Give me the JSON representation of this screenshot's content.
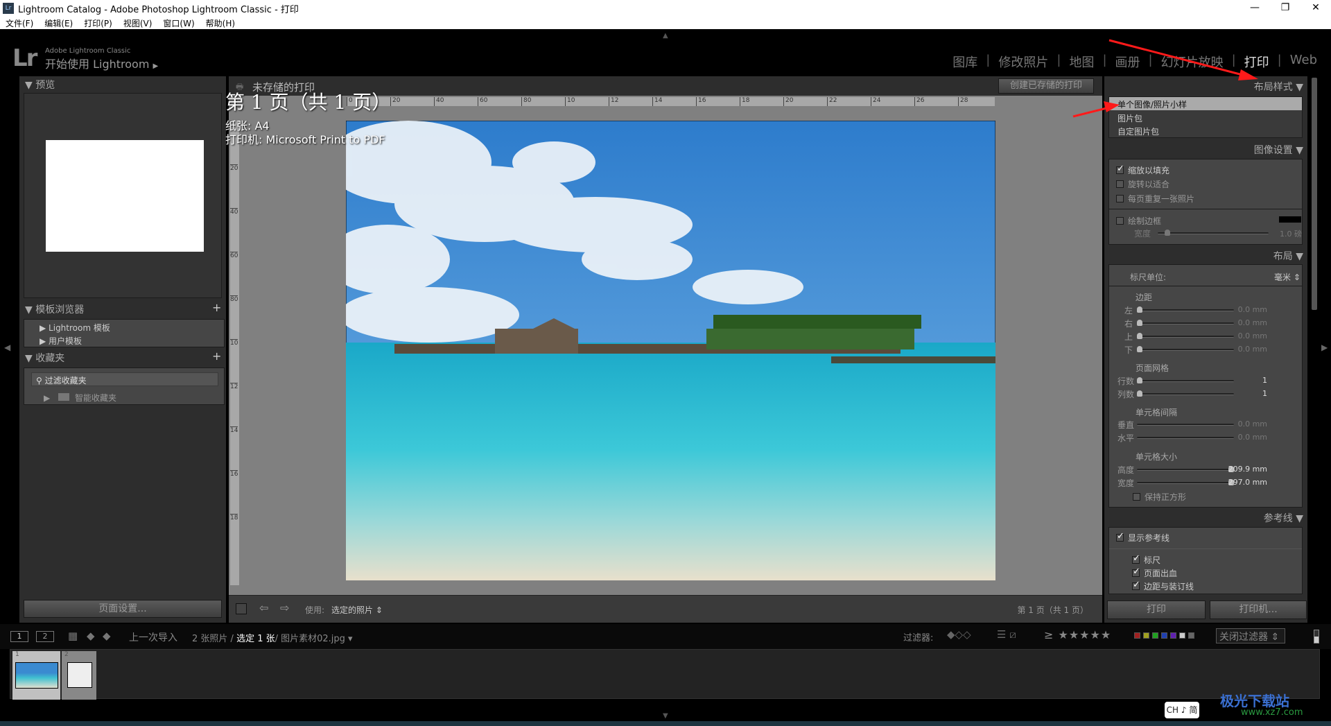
{
  "window": {
    "title": "Lightroom Catalog - Adobe Photoshop Lightroom Classic - 打印",
    "app_icon": "Lr",
    "controls": [
      "minimize-icon",
      "maximize-icon",
      "close-icon"
    ]
  },
  "menu": [
    "文件(F)",
    "编辑(E)",
    "打印(P)",
    "视图(V)",
    "窗口(W)",
    "帮助(H)"
  ],
  "identity": {
    "logo": "Lr",
    "brand": "Adobe Lightroom Classic",
    "subtitle": "开始使用 Lightroom"
  },
  "modules": [
    {
      "label": "图库"
    },
    {
      "label": "修改照片"
    },
    {
      "label": "地图"
    },
    {
      "label": "画册"
    },
    {
      "label": "幻灯片放映"
    },
    {
      "label": "打印",
      "active": true
    },
    {
      "label": "Web"
    }
  ],
  "left": {
    "preview_title": "预览",
    "template_browser": {
      "title": "模板浏览器",
      "items": [
        "Lightroom 模板",
        "用户模板"
      ]
    },
    "collections": {
      "title": "收藏夹",
      "filter_placeholder": "过滤收藏夹",
      "items": [
        "智能收藏夹"
      ]
    },
    "page_setup": "页面设置..."
  },
  "center": {
    "print_title": "未存储的打印",
    "create_saved": "创建已存储的打印",
    "ruler_top": [
      "0",
      "20",
      "40",
      "60",
      "80",
      "10",
      "12",
      "14",
      "16",
      "18",
      "20",
      "22",
      "24",
      "26",
      "28"
    ],
    "ruler_left": [
      "0",
      "20",
      "40",
      "60",
      "80",
      "10",
      "12",
      "14",
      "16",
      "18"
    ],
    "page_info": {
      "page": "第 1 页（共 1 页）",
      "paper": "纸张: A4",
      "printer": "打印机: Microsoft Print to PDF"
    },
    "toolbar": {
      "use_label": "使用:",
      "use_value": "选定的照片",
      "page_status": "第 1 页（共 1 页）"
    }
  },
  "right": {
    "layout_style": {
      "title": "布局样式",
      "items": [
        "单个图像/照片小样",
        "图片包",
        "自定图片包"
      ],
      "selected": 0
    },
    "image_settings": {
      "title": "图像设置",
      "options": [
        {
          "label": "缩放以填充",
          "checked": true
        },
        {
          "label": "旋转以适合",
          "checked": false
        },
        {
          "label": "每页重复一张照片",
          "checked": false
        }
      ],
      "border": {
        "label": "绘制边框",
        "checked": false,
        "color": "#000000",
        "width_label": "宽度",
        "width_value": "1.0 磅"
      }
    },
    "layout": {
      "title": "布局",
      "ruler_unit_label": "标尺单位:",
      "ruler_unit": "毫米",
      "margins_title": "边距",
      "margins": [
        {
          "label": "左",
          "value": "0.0 mm"
        },
        {
          "label": "右",
          "value": "0.0 mm"
        },
        {
          "label": "上",
          "value": "0.0 mm"
        },
        {
          "label": "下",
          "value": "0.0 mm"
        }
      ],
      "grid_title": "页面网格",
      "grid": [
        {
          "label": "行数",
          "value": "1"
        },
        {
          "label": "列数",
          "value": "1"
        }
      ],
      "spacing_title": "单元格间隔",
      "spacing": [
        {
          "label": "垂直",
          "value": "0.0 mm"
        },
        {
          "label": "水平",
          "value": "0.0 mm"
        }
      ],
      "size_title": "单元格大小",
      "size": [
        {
          "label": "高度",
          "value": "209.9 mm"
        },
        {
          "label": "宽度",
          "value": "297.0 mm"
        }
      ],
      "keep_square": {
        "label": "保持正方形",
        "checked": false
      }
    },
    "guides": {
      "title": "参考线",
      "show": {
        "label": "显示参考线",
        "checked": true
      },
      "items": [
        {
          "label": "标尺",
          "checked": true
        },
        {
          "label": "页面出血",
          "checked": true
        },
        {
          "label": "边距与装订线",
          "checked": true
        }
      ]
    },
    "print_button": "打印",
    "printer_button": "打印机..."
  },
  "filmstrip": {
    "view1": "1",
    "view2": "2",
    "source": "上一次导入",
    "count": "2 张照片 /",
    "selected": "选定 1 张",
    "file": "/ 图片素材02.jpg",
    "filter_label": "过滤器:",
    "filter_off": "关闭过滤器",
    "color_labels": [
      "#a02020",
      "#a0a020",
      "#20a020",
      "#2040b0",
      "#6020b0",
      "#cccccc",
      "#666666"
    ],
    "thumbs": [
      {
        "index": "1"
      },
      {
        "index": "2"
      }
    ]
  },
  "ime": "CH ♪ 简",
  "watermark": {
    "name": "极光下载站",
    "url": "www.xz7.com"
  },
  "colors": {
    "annotation_arrow": "#ff1a1a",
    "panel": "#3a3a3a",
    "canvas": "#808080"
  }
}
